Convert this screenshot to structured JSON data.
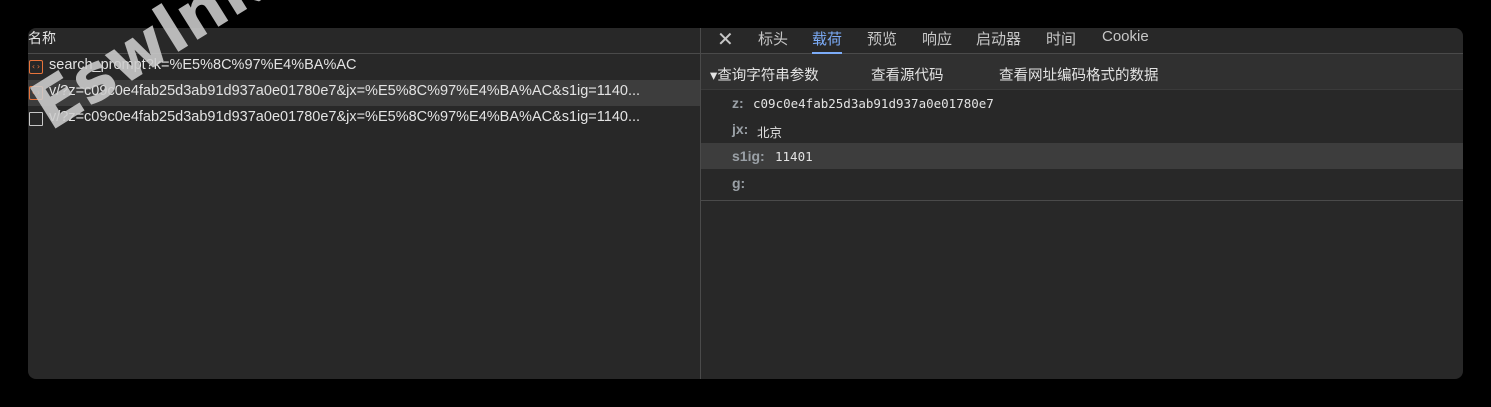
{
  "requests": {
    "column_header": "名称",
    "rows": [
      {
        "text": "search_prompt?k=%E5%8C%97%E4%BA%AC",
        "icon": "xhr-icon"
      },
      {
        "text": "v/?z=c09c0e4fab25d3ab91d937a0e01780e7&jx=%E5%8C%97%E4%BA%AC&s1ig=1140...",
        "icon": "xhr-icon"
      },
      {
        "text": "v/?z=c09c0e4fab25d3ab91d937a0e01780e7&jx=%E5%8C%97%E4%BA%AC&s1ig=1140...",
        "icon": "document-icon"
      }
    ]
  },
  "tabs": {
    "close": "✕",
    "items": [
      "标头",
      "载荷",
      "预览",
      "响应",
      "启动器",
      "时间",
      "Cookie"
    ],
    "active": "载荷"
  },
  "payload": {
    "section_toggle": "▾查询字符串参数",
    "view_source": "查看源代码",
    "view_url_encoded": "查看网址编码格式的数据",
    "params": [
      {
        "key": "z:",
        "value": "c09c0e4fab25d3ab91d937a0e01780e7"
      },
      {
        "key": "jx:",
        "value": "北京"
      },
      {
        "key": "s1ig:",
        "value": "11401"
      },
      {
        "key": "g:",
        "value": ""
      }
    ]
  },
  "watermark": "Eswlnk Blog",
  "colors": {
    "accent": "#7cacf8",
    "panel": "#282828",
    "background": "#000000",
    "xhr_icon": "#e8743b"
  }
}
